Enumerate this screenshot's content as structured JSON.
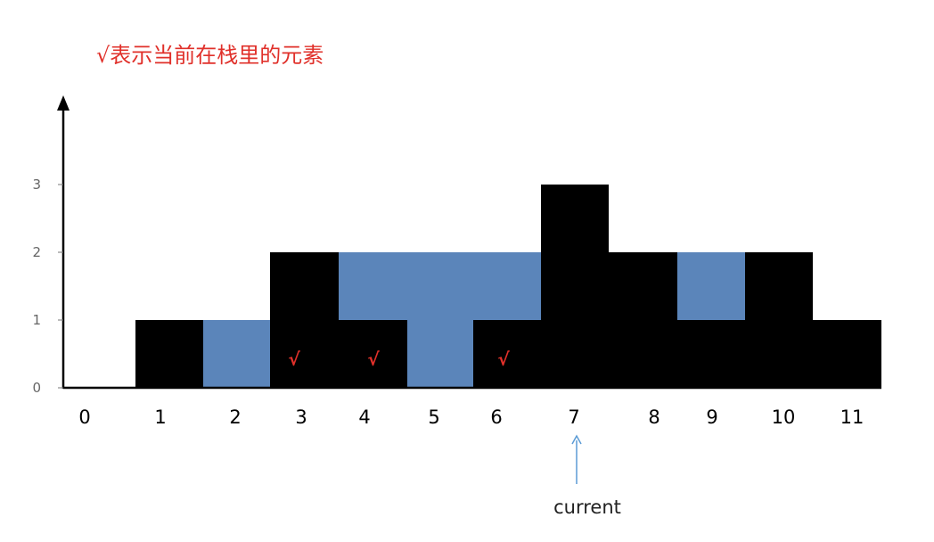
{
  "chart_data": {
    "type": "bar",
    "title": "√表示当前在栈里的元素",
    "xlabel": "",
    "ylabel": "",
    "categories": [
      "0",
      "1",
      "2",
      "3",
      "4",
      "5",
      "6",
      "7",
      "8",
      "9",
      "10",
      "11"
    ],
    "series": [
      {
        "values": [
          0,
          1,
          0,
          2,
          1,
          0,
          1,
          3,
          2,
          1,
          2,
          1
        ]
      },
      {
        "values": [
          0,
          0,
          1,
          0,
          1,
          2,
          1,
          0,
          0,
          1,
          0,
          0
        ]
      }
    ],
    "yticks": [
      "0",
      "1",
      "2",
      "3"
    ],
    "ylim": [
      0,
      3
    ],
    "stack_marks": {
      "symbol": "√",
      "indices": [
        3,
        4,
        6
      ]
    },
    "current": {
      "index": 7,
      "label": "current"
    },
    "colors": {
      "bar": "#000000",
      "water": "#5b85ba",
      "mark": "#e0302a",
      "arrow": "#5b9bd5"
    },
    "grid": false
  }
}
